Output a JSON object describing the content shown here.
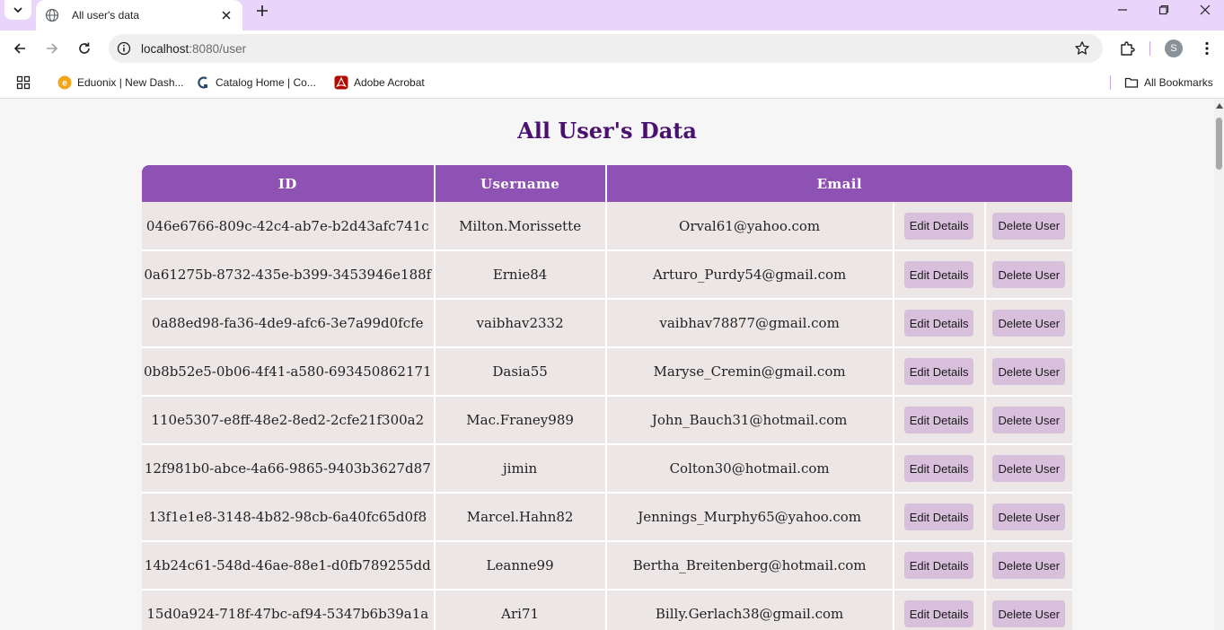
{
  "browser": {
    "tab_title": "All user's data",
    "url_host": "localhost",
    "url_rest": ":8080/user",
    "profile_initial": "S",
    "bookmarks": [
      {
        "label": "Eduonix | New Dash...",
        "icon": "eduonix-favicon"
      },
      {
        "label": "Catalog Home | Co...",
        "icon": "catalog-favicon"
      },
      {
        "label": "Adobe Acrobat",
        "icon": "acrobat-favicon"
      }
    ],
    "all_bookmarks_label": "All Bookmarks"
  },
  "page": {
    "title": "All User's Data",
    "columns": [
      "ID",
      "Username",
      "Email"
    ],
    "edit_label": "Edit Details",
    "delete_label": "Delete User",
    "rows": [
      {
        "id": "046e6766-809c-42c4-ab7e-b2d43afc741c",
        "username": "Milton.Morissette",
        "email": "Orval61@yahoo.com"
      },
      {
        "id": "0a61275b-8732-435e-b399-3453946e188f",
        "username": "Ernie84",
        "email": "Arturo_Purdy54@gmail.com"
      },
      {
        "id": "0a88ed98-fa36-4de9-afc6-3e7a99d0fcfe",
        "username": "vaibhav2332",
        "email": "vaibhav78877@gmail.com"
      },
      {
        "id": "0b8b52e5-0b06-4f41-a580-693450862171",
        "username": "Dasia55",
        "email": "Maryse_Cremin@gmail.com"
      },
      {
        "id": "110e5307-e8ff-48e2-8ed2-2cfe21f300a2",
        "username": "Mac.Franey989",
        "email": "John_Bauch31@hotmail.com"
      },
      {
        "id": "12f981b0-abce-4a66-9865-9403b3627d87",
        "username": "jimin",
        "email": "Colton30@hotmail.com"
      },
      {
        "id": "13f1e1e8-3148-4b82-98cb-6a40fc65d0f8",
        "username": "Marcel.Hahn82",
        "email": "Jennings_Murphy65@yahoo.com"
      },
      {
        "id": "14b24c61-548d-46ae-88e1-d0fb789255dd",
        "username": "Leanne99",
        "email": "Bertha_Breitenberg@hotmail.com"
      },
      {
        "id": "15d0a924-718f-47bc-af94-5347b6b39a1a",
        "username": "Ari71",
        "email": "Billy.Gerlach38@gmail.com"
      }
    ]
  }
}
